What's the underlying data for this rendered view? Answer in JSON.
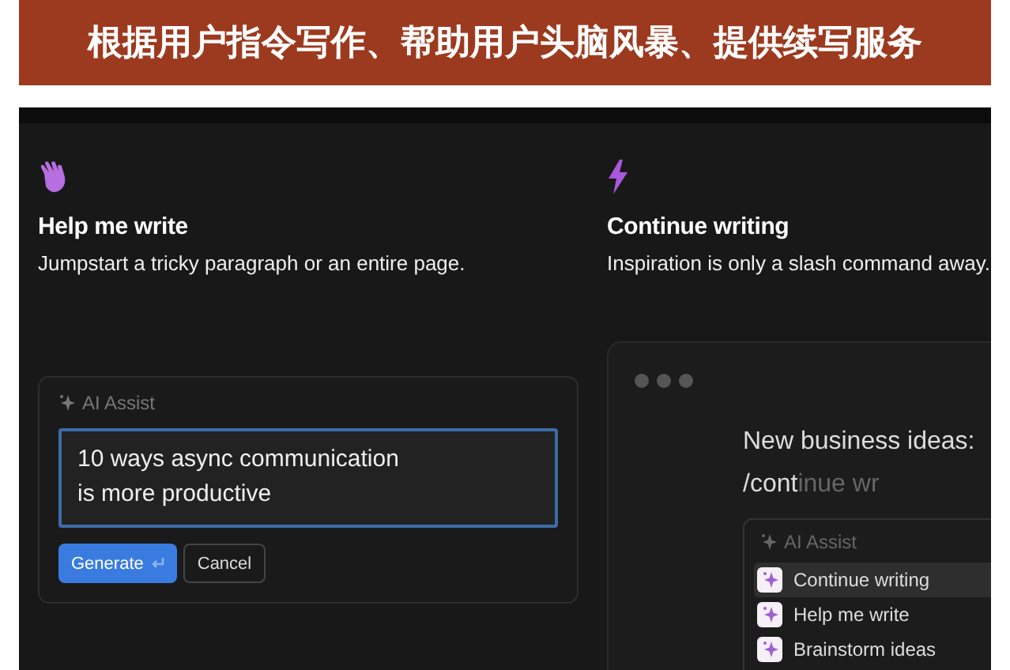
{
  "banner": {
    "title": "根据用户指令写作、帮助用户头脑风暴、提供续写服务"
  },
  "features": [
    {
      "kind": "wave",
      "title": "Help me write",
      "subtitle": "Jumpstart a tricky paragraph or an entire page."
    },
    {
      "kind": "bolt",
      "title": "Continue writing",
      "subtitle": "Inspiration is only a slash command away."
    }
  ],
  "assist_card": {
    "label": "AI Assist",
    "prompt": "10 ways async communication\nis more productive",
    "buttons": [
      {
        "kind": "primary",
        "label": "Generate"
      },
      {
        "kind": "secondary",
        "label": "Cancel"
      }
    ]
  },
  "editor": {
    "heading": "New business ideas:",
    "command_typed": "/cont",
    "command_suggestion": "inue wr",
    "menu": {
      "label": "AI Assist",
      "items": [
        {
          "label": "Continue writing",
          "selected": true
        },
        {
          "label": "Help me write",
          "selected": false
        },
        {
          "label": "Brainstorm ideas",
          "selected": false
        }
      ]
    }
  }
}
